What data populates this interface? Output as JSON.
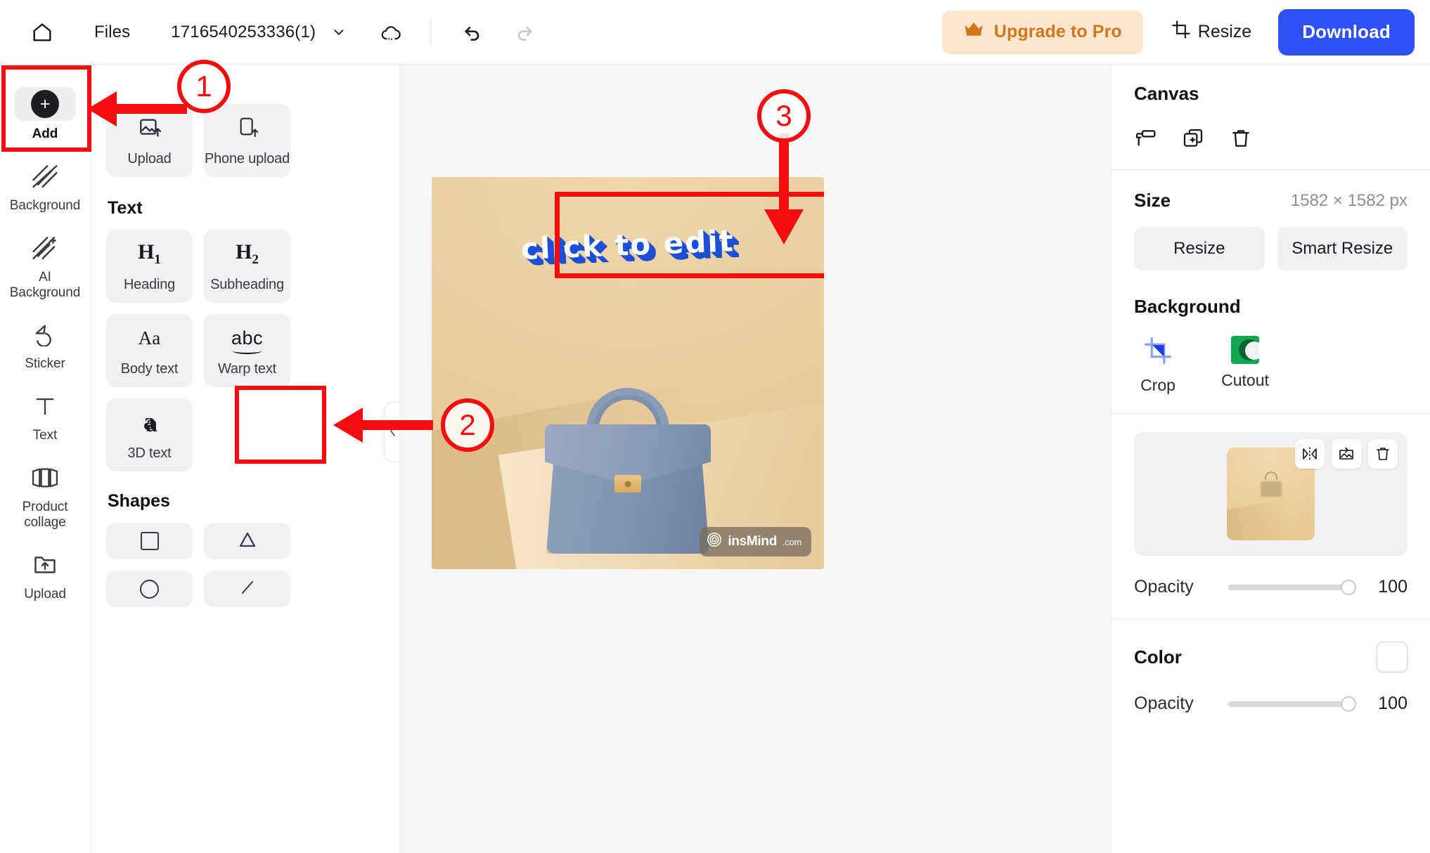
{
  "topbar": {
    "home_icon": "home-icon",
    "files_label": "Files",
    "filename": "1716540253336(1)",
    "dropdown_icon": "chevron-down-icon",
    "cloud_icon": "cloud-sync-icon",
    "undo_icon": "undo-icon",
    "redo_icon": "redo-icon",
    "upgrade_label": "Upgrade to Pro",
    "upgrade_icon": "crown-icon",
    "resize_label": "Resize",
    "resize_icon": "crop-icon",
    "download_label": "Download",
    "accent_blue": "#2f50f5",
    "upgrade_bg": "#fbe6cd",
    "upgrade_fg": "#d1761b"
  },
  "rail": {
    "items": [
      {
        "label": "Add",
        "icon": "plus-circle-icon",
        "active": true
      },
      {
        "label": "Background",
        "icon": "hatch-icon",
        "active": false
      },
      {
        "label": "AI Background",
        "icon": "hatch-sparkle-icon",
        "active": false
      },
      {
        "label": "Sticker",
        "icon": "sticker-icon",
        "active": false
      },
      {
        "label": "Text",
        "icon": "text-t-icon",
        "active": false
      },
      {
        "label": "Product collage",
        "icon": "collage-icon",
        "active": false
      },
      {
        "label": "Upload",
        "icon": "folder-upload-icon",
        "active": false
      }
    ]
  },
  "panel": {
    "upload_cards": [
      {
        "label": "Upload",
        "icon": "image-upload-icon"
      },
      {
        "label": "Phone upload",
        "icon": "phone-upload-icon"
      }
    ],
    "text_section_title": "Text",
    "text_cards": [
      {
        "label": "Heading",
        "icon": "h1-icon",
        "glyph": "H1"
      },
      {
        "label": "Subheading",
        "icon": "h2-icon",
        "glyph": "H2"
      },
      {
        "label": "Body text",
        "icon": "aa-icon",
        "glyph": "Aa"
      },
      {
        "label": "Warp text",
        "icon": "warp-text-icon",
        "glyph": "abc"
      },
      {
        "label": "3D text",
        "icon": "three-d-text-icon",
        "glyph": "a"
      }
    ],
    "shapes_section_title": "Shapes",
    "shape_cards": [
      {
        "label": "square",
        "icon": "square-shape-icon"
      },
      {
        "label": "triangle",
        "icon": "triangle-shape-icon"
      },
      {
        "label": "circle",
        "icon": "circle-shape-icon"
      },
      {
        "label": "line",
        "icon": "line-shape-icon"
      }
    ],
    "collapse_icon": "chevron-left-icon"
  },
  "canvas": {
    "text_layer": "click to edit",
    "text_color": "#ffffff",
    "text_extrude_color": "#1d4fd8",
    "watermark": "insMind",
    "watermark_suffix": ".com",
    "watermark_icon": "spiral-logo-icon",
    "background_color": "#eecfa0"
  },
  "props": {
    "title": "Canvas",
    "tool_icons": [
      "paint-roller-icon",
      "duplicate-icon",
      "trash-icon"
    ],
    "size_label": "Size",
    "size_value": "1582 × 1582 px",
    "resize_label": "Resize",
    "smart_resize_label": "Smart Resize",
    "background_title": "Background",
    "bg_tools": [
      {
        "label": "Crop",
        "icon": "crop-tool-icon"
      },
      {
        "label": "Cutout",
        "icon": "cutout-tool-icon"
      }
    ],
    "thumb_actions": [
      "flip-icon",
      "replace-image-icon",
      "trash-icon"
    ],
    "opacity_label": "Opacity",
    "opacity_value": "100",
    "color_label": "Color",
    "color_value": "#ffffff",
    "color_opacity_label": "Opacity",
    "color_opacity_value": "100"
  },
  "annotations": {
    "marker_1": "1",
    "marker_2": "2",
    "marker_3": "3",
    "color": "#f50d0d"
  }
}
